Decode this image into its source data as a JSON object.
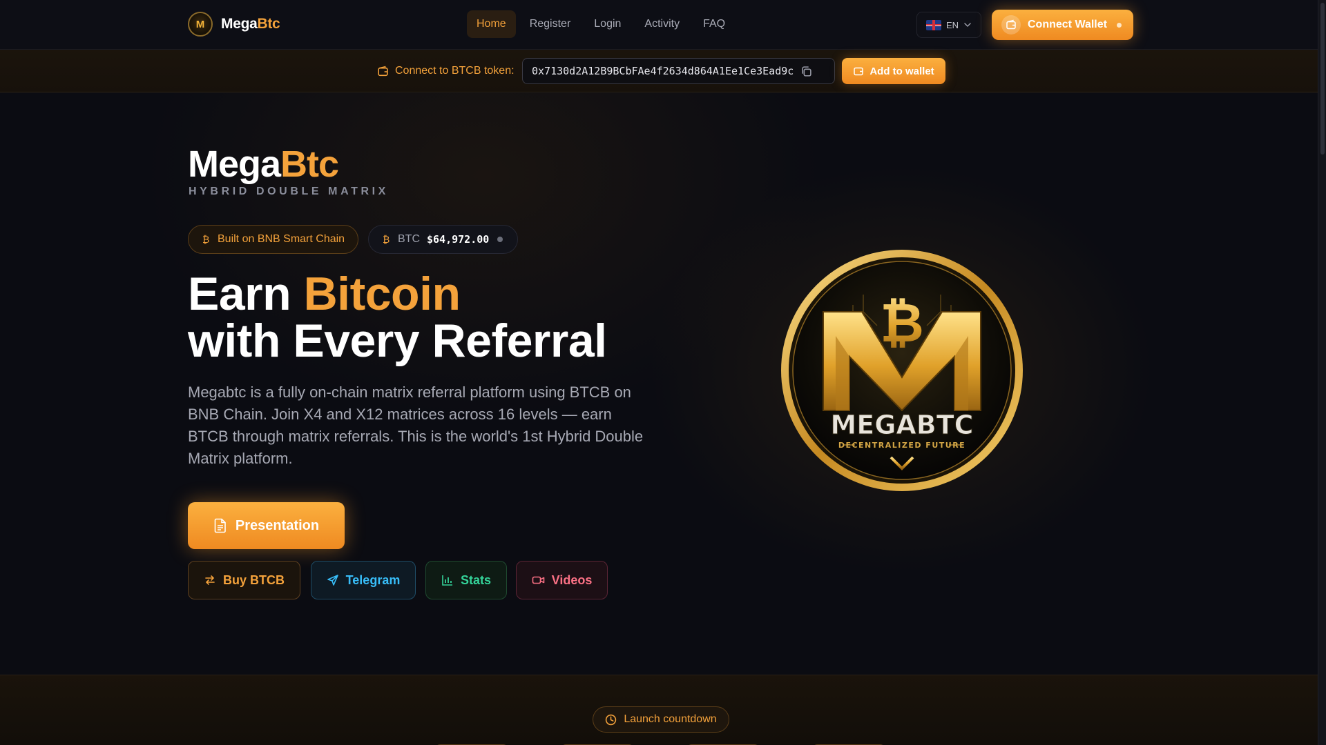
{
  "nav": {
    "brand_prefix": "Mega",
    "brand_accent": "Btc",
    "logo_letter": "M",
    "items": [
      {
        "label": "Home",
        "active": true
      },
      {
        "label": "Register",
        "active": false
      },
      {
        "label": "Login",
        "active": false
      },
      {
        "label": "Activity",
        "active": false
      },
      {
        "label": "FAQ",
        "active": false
      }
    ],
    "language": "EN",
    "connect_label": "Connect Wallet"
  },
  "token_bar": {
    "label": "Connect to BTCB token:",
    "address": "0x7130d2A12B9BCbFAe4f2634d864A1Ee1Ce3Ead9c",
    "add_label": "Add to wallet"
  },
  "hero": {
    "title_prefix": "Mega",
    "title_accent": "Btc",
    "subtitle": "HYBRID DOUBLE MATRIX",
    "chain_chip": "Built on BNB Smart Chain",
    "btc_label": "BTC",
    "btc_price": "$64,972.00",
    "headline_prefix": "Earn ",
    "headline_accent": "Bitcoin",
    "headline_line2": "with Every Referral",
    "description": "Megabtc is a fully on-chain matrix referral platform using BTCB on BNB Chain. Join X4 and X12 matrices across 16 levels — earn BTCB through matrix referrals. This is the world's 1st Hybrid Double Matrix platform.",
    "presentation_label": "Presentation",
    "buttons": {
      "buy": "Buy BTCB",
      "telegram": "Telegram",
      "stats": "Stats",
      "videos": "Videos"
    },
    "coin_text": "MEGABTC",
    "coin_tagline": "DECENTRALIZED FUTURE"
  },
  "countdown": {
    "label": "Launch countdown"
  },
  "colors": {
    "accent": "#f4a23b",
    "telegram": "#38bdf8",
    "stats": "#34d399",
    "videos": "#fb7185",
    "background": "#0b0c12"
  }
}
